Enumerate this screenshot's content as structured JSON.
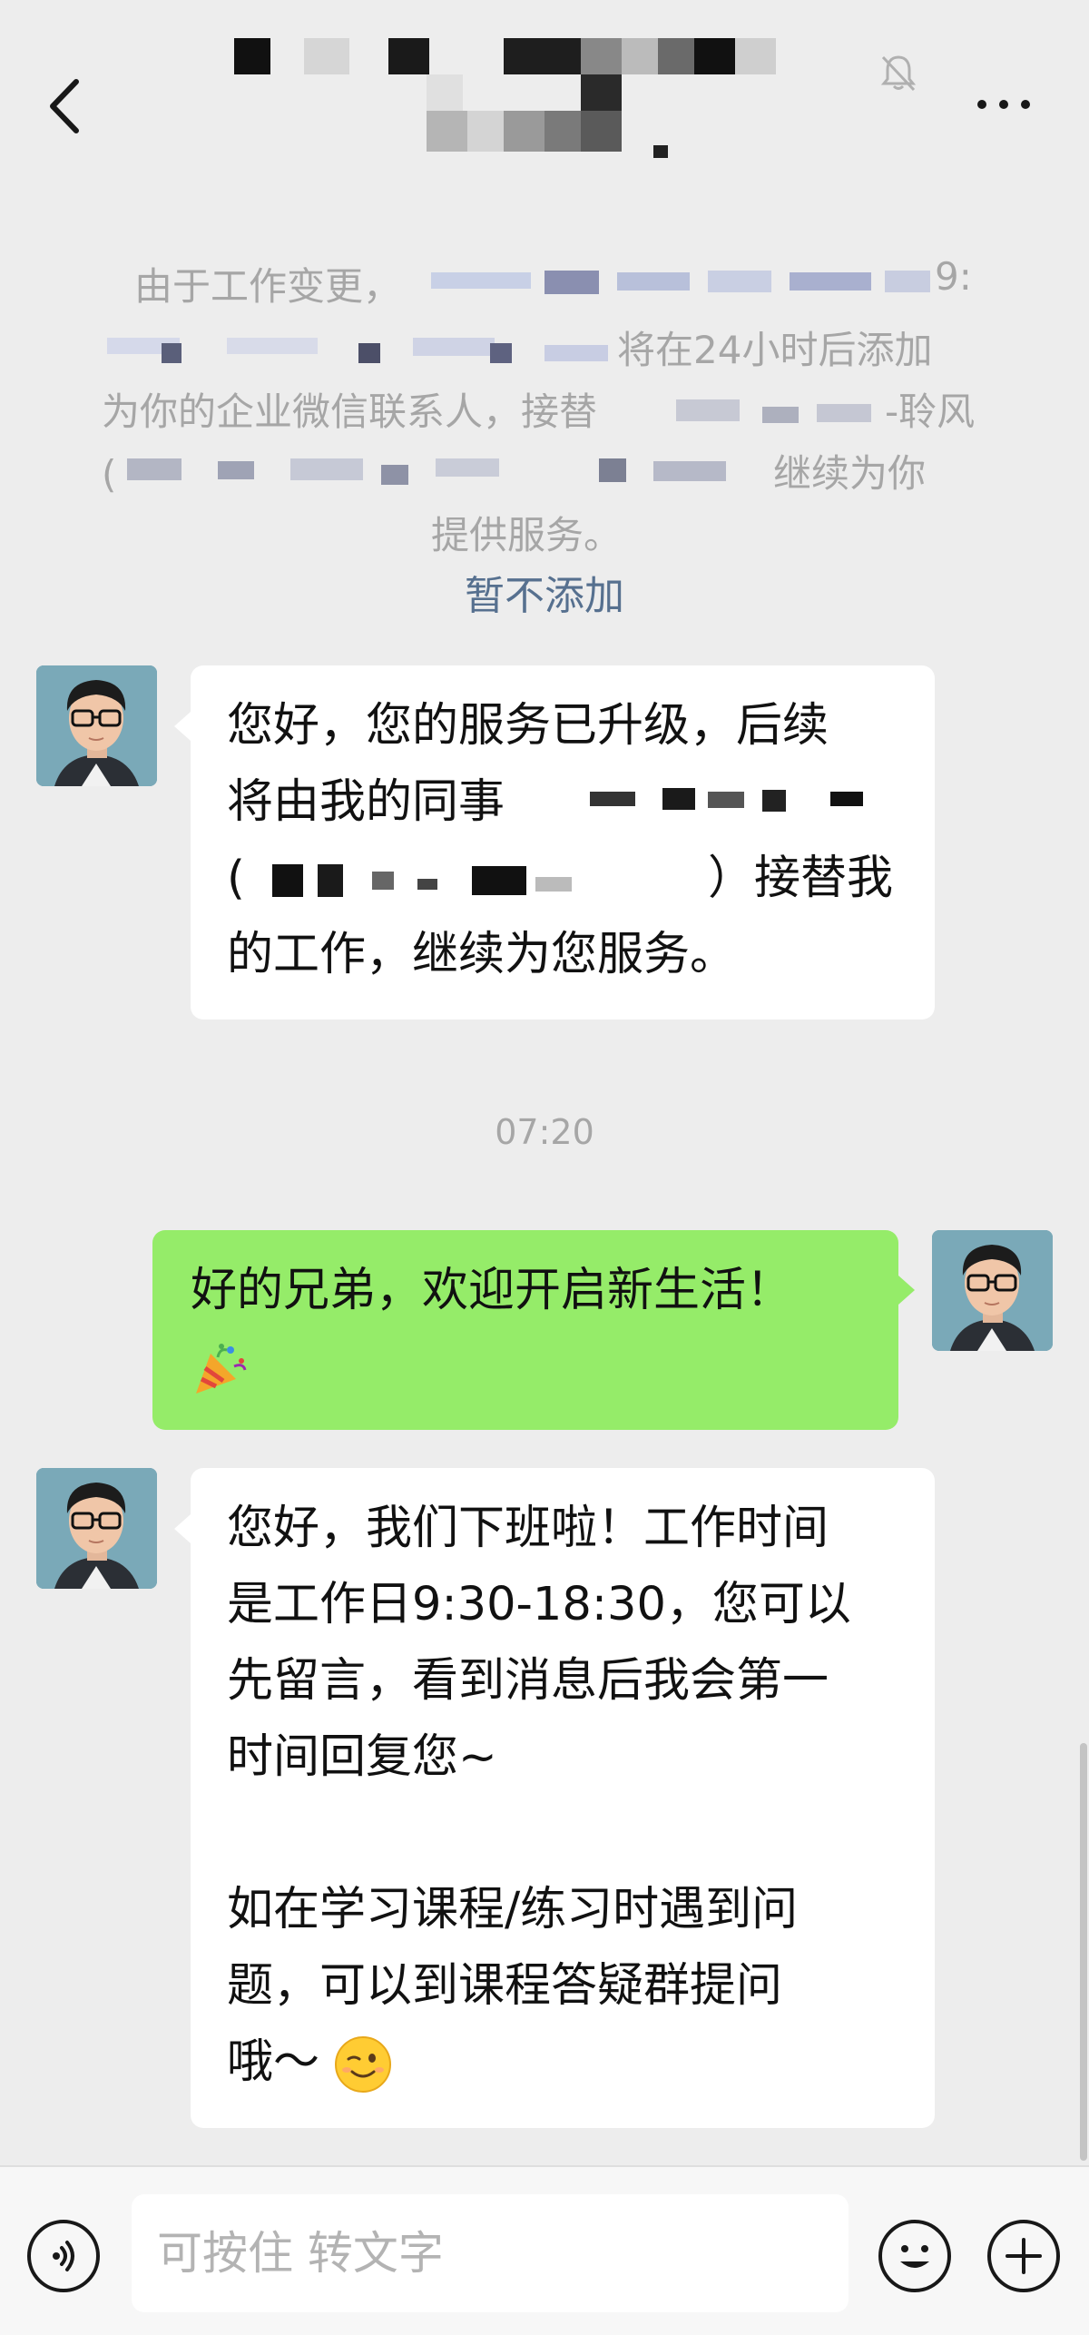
{
  "header": {
    "title": "",
    "back_icon": "chevron-left-icon",
    "mute_icon": "bell-off-icon",
    "more_icon": "more-horizontal-icon"
  },
  "system_notice": {
    "lines": [
      "由于工作变更，",
      "将在24小时后添加",
      "为你的企业微信联系人，接替",
      "继续为你",
      "提供服务。"
    ],
    "action_label": "暂不添加"
  },
  "messages": {
    "msg1_lines": [
      "您好，您的服务已升级，后续",
      "将由我的同事",
      "）接替我",
      "的工作，继续为您服务。"
    ],
    "timestamp": "07:20",
    "msg2_line1": "好的兄弟，欢迎开启新生活！",
    "msg3_lines": [
      "您好，我们下班啦！工作时间",
      "是工作日9:30-18:30，您可以",
      "先留言，看到消息后我会第一",
      "时间回复您~",
      "如在学习课程/练习时遇到问",
      "题，可以到课程答疑群提问",
      "哦～"
    ],
    "emoji_party": "party-popper-icon",
    "emoji_wink": "wink-face-icon"
  },
  "input_bar": {
    "placeholder": "可按住 转文字",
    "voice_icon": "voice-icon",
    "emoji_icon": "smile-icon",
    "plus_icon": "plus-icon"
  },
  "colors": {
    "background": "#ededed",
    "outgoing_bubble": "#95ec69",
    "incoming_bubble": "#ffffff",
    "link": "#56708f"
  }
}
